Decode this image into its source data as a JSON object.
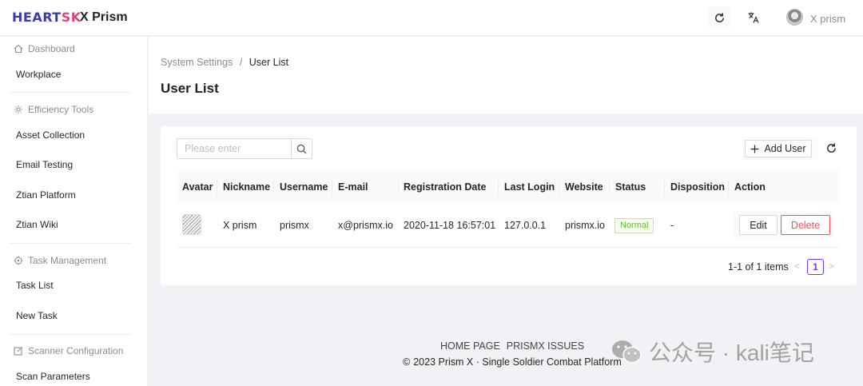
{
  "header": {
    "logo_a": "HEART",
    "logo_b": "SK",
    "app_title": "X Prism",
    "user_name": "X prism"
  },
  "sidebar": {
    "groups": [
      {
        "label": "Dashboard",
        "icon": "home-icon",
        "items": [
          "Workplace"
        ]
      },
      {
        "label": "Efficiency Tools",
        "icon": "gear-icon",
        "items": [
          "Asset Collection",
          "Email Testing",
          "Ztian Platform",
          "Ztian Wiki"
        ]
      },
      {
        "label": "Task Management",
        "icon": "target-icon",
        "items": [
          "Task List",
          "New Task"
        ]
      },
      {
        "label": "Scanner Configuration",
        "icon": "edit-icon",
        "items": [
          "Scan Parameters"
        ]
      }
    ]
  },
  "breadcrumb": {
    "parent": "System Settings",
    "separator": "/",
    "current": "User List"
  },
  "page_title": "User List",
  "search": {
    "placeholder": "Please enter"
  },
  "toolbar": {
    "add_user_label": "Add User"
  },
  "table": {
    "columns": [
      "Avatar",
      "Nickname",
      "Username",
      "E-mail",
      "Registration Date",
      "Last Login",
      "Website",
      "Status",
      "Disposition",
      "Action"
    ],
    "rows": [
      {
        "nickname": "X prism",
        "username": "prismx",
        "email": "x@prismx.io",
        "registration_date": "2020-11-18 16:57:01",
        "last_login": "127.0.0.1",
        "website": "prismx.io",
        "status": "Normal",
        "disposition": "-",
        "edit_label": "Edit",
        "delete_label": "Delete"
      }
    ]
  },
  "pagination": {
    "total_text": "1-1 of 1 items",
    "current_page": "1",
    "prev": "<",
    "next": ">"
  },
  "footer": {
    "links": [
      "HOME PAGE",
      "PRISMX ISSUES"
    ],
    "copyright_symbol": "©",
    "copyright": "2023 Prism X · Single Soldier Combat Platform"
  },
  "watermark": {
    "text": "公众号 · kali笔记"
  },
  "colors": {
    "accent": "#7b2ff7",
    "danger": "#ff4d4f",
    "success": "#52c41a"
  }
}
